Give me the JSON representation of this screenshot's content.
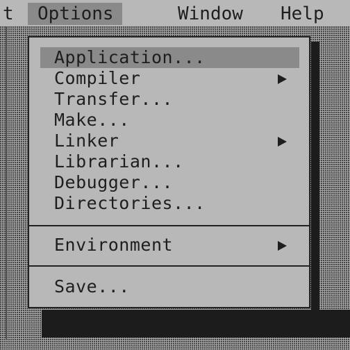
{
  "menubar": {
    "items": [
      {
        "label": "t"
      },
      {
        "label": "Options",
        "active": true
      },
      {
        "label": "Window"
      },
      {
        "label": "Help"
      }
    ]
  },
  "options_menu": {
    "groups": [
      [
        {
          "label": "Application...",
          "highlighted": true,
          "submenu": false
        },
        {
          "label": "Compiler",
          "submenu": true
        },
        {
          "label": "Transfer...",
          "submenu": false
        },
        {
          "label": "Make...",
          "submenu": false
        },
        {
          "label": "Linker",
          "submenu": true
        },
        {
          "label": "Librarian...",
          "submenu": false
        },
        {
          "label": "Debugger...",
          "submenu": false
        },
        {
          "label": "Directories...",
          "submenu": false
        }
      ],
      [
        {
          "label": "Environment",
          "submenu": true
        }
      ],
      [
        {
          "label": "Save...",
          "submenu": false
        }
      ]
    ]
  },
  "colors": {
    "background": "#b8b8b8",
    "highlight": "#8a8a8a",
    "text": "#1e1e1e",
    "border": "#222222"
  }
}
